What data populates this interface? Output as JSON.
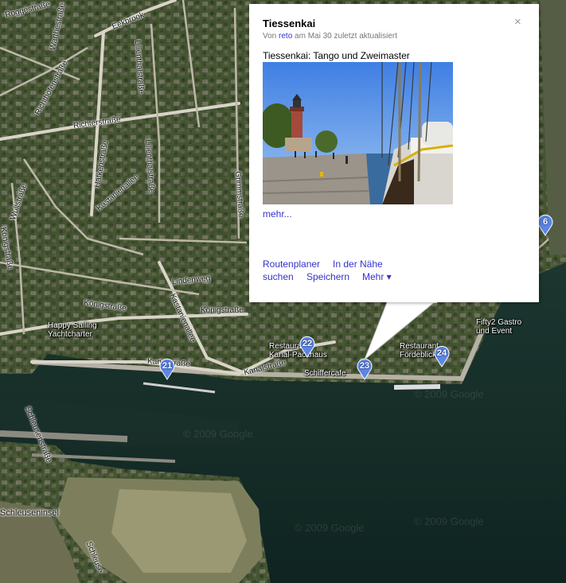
{
  "streets": {
    "roggestrasse": "Roggestraße",
    "eekbrook": "Eekbrook",
    "warthestrasse": "Warthestraße",
    "lilienthal1": "Lilienthalstraße",
    "lilienthal2": "Lilienthalstraße",
    "richthofen": "Richthofenstraße",
    "richterstrasse": "Richterstraße",
    "hafkenstrasse": "Hafkenstraße",
    "grimmstrasse": "Grimmstraße",
    "wullstrasse": "Wullstraße",
    "kastanienallee1": "Kastanienallee",
    "koenigstrasse_v": "Königstraße",
    "lindenweg": "Lindenweg",
    "koenigstrasse1": "Königstraße",
    "koenigstrasse2": "Königstraße",
    "kastanienallee2": "Kastanienallee",
    "kanalstrasse1": "Kanalstraße",
    "kanalstrasse2": "Kanalstraße",
    "schleusenstrasse": "Schleusenstraße",
    "schleuseninsel": "Schleuseninsel",
    "schleuse_v": "Schleuse"
  },
  "places": {
    "happy_sailing": "Happy Sailing",
    "yachtcharter": "Yachtcharter",
    "restaurant_pack_1": "Restaurant",
    "restaurant_pack_2": "Kanal-Packhaus",
    "schiffercafe": "Schiffercafe",
    "restaurant_foerde_1": "Restaurant",
    "restaurant_foerde_2": "Fördeblick",
    "fifty2_1": "Fifty2 Gastro",
    "fifty2_2": "und Event"
  },
  "watermarks": {
    "w1": "© 2009 Google",
    "w2": "© 2009 Google",
    "w3": "© 2009 Google",
    "w4": "© 2009 Google"
  },
  "markers": [
    {
      "label": "21"
    },
    {
      "label": "22"
    },
    {
      "label": "23"
    },
    {
      "label": "24"
    },
    {
      "label": "6"
    }
  ],
  "marker_color": "#5b86e5",
  "infowindow": {
    "title": "Tiessenkai",
    "close_symbol": "×",
    "meta_prefix": "Von",
    "meta_user": "reto",
    "meta_suffix": "am Mai 30 zuletzt aktualisiert",
    "description": "Tiessenkai: Tango und Zweimaster",
    "more": "mehr...",
    "links": {
      "routenplaner": "Routenplaner",
      "in_der_naehe": "In der Nähe",
      "suchen": "suchen",
      "speichern": "Speichern",
      "mehr_menu": "Mehr ▾"
    }
  },
  "link_color": "#3333cc"
}
